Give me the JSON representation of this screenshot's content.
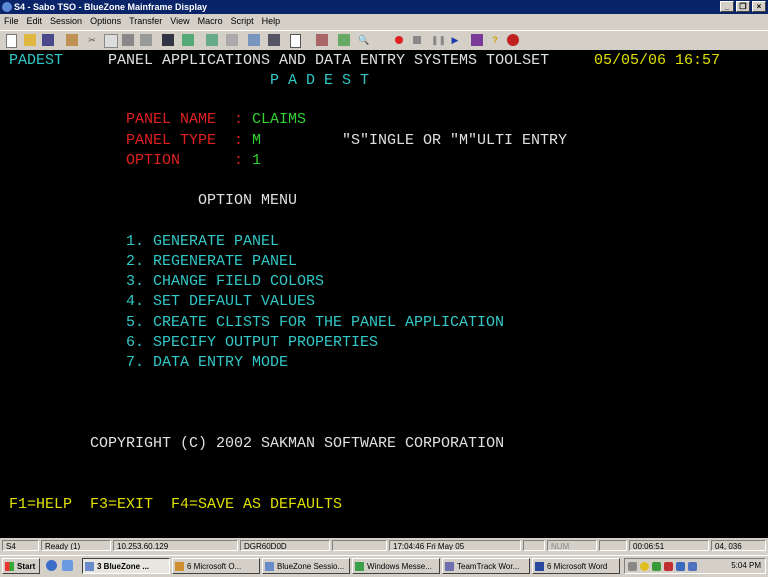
{
  "window": {
    "title": "S4 - Sabo TSO - BlueZone Mainframe Display",
    "buttons": {
      "minimize": "_",
      "maximize": "❐",
      "close": "×"
    }
  },
  "menu": [
    "File",
    "Edit",
    "Session",
    "Options",
    "Transfer",
    "View",
    "Macro",
    "Script",
    "Help"
  ],
  "toolbar_icons": [
    "new-icon",
    "open-icon",
    "save-icon",
    "home-icon",
    "cut-icon",
    "copy-icon",
    "print-icon",
    "print-screen-icon",
    "display-icon",
    "settings-icon",
    "connect-icon",
    "keyboard-icon",
    "ftp-icon",
    "host-icon",
    "document-icon",
    "edit-icon",
    "find-icon",
    "zoom-icon",
    "record-icon",
    "stop-icon",
    "pause-icon",
    "play-icon",
    "book-icon",
    "help-icon",
    "apple-icon"
  ],
  "terminal": {
    "app_id": "PADEST",
    "header_title": "PANEL APPLICATIONS AND DATA ENTRY SYSTEMS TOOLSET",
    "date": "05/05/06",
    "time": "16:57",
    "subtitle": "P A D E S T",
    "panel_name_label": "PANEL NAME  :",
    "panel_name_value": "CLAIMS",
    "panel_type_label": "PANEL TYPE  :",
    "panel_type_value": "M",
    "panel_type_hint": "\"S\"INGLE OR \"M\"ULTI ENTRY",
    "option_label": "OPTION      :",
    "option_value": "1",
    "option_menu_title": "OPTION MENU",
    "options": [
      "1. GENERATE PANEL",
      "2. REGENERATE PANEL",
      "3. CHANGE FIELD COLORS",
      "4. SET DEFAULT VALUES",
      "5. CREATE CLISTS FOR THE PANEL APPLICATION",
      "6. SPECIFY OUTPUT PROPERTIES",
      "7. DATA ENTRY MODE"
    ],
    "copyright": "COPYRIGHT (C) 2002 SAKMAN SOFTWARE CORPORATION",
    "function_keys": "F1=HELP  F3=EXIT  F4=SAVE AS DEFAULTS"
  },
  "statusbar": {
    "session": "S4",
    "state": "Ready (1)",
    "ip": "10.253.60.129",
    "lu": "DGR60D0D",
    "blank1": "",
    "timestamp": "17:04:46  Fri May 05",
    "blank2": "",
    "num": "NUM",
    "blank3": "",
    "elapsed": "00:06:51",
    "cursor": "04, 036"
  },
  "taskbar": {
    "start": "Start",
    "tasks": [
      "3 BlueZone ...",
      "6 Microsoft O...",
      "BlueZone Sessio...",
      "Windows Messe...",
      "TeamTrack Wor...",
      "6 Microsoft Word"
    ],
    "clock": "5:04 PM"
  }
}
